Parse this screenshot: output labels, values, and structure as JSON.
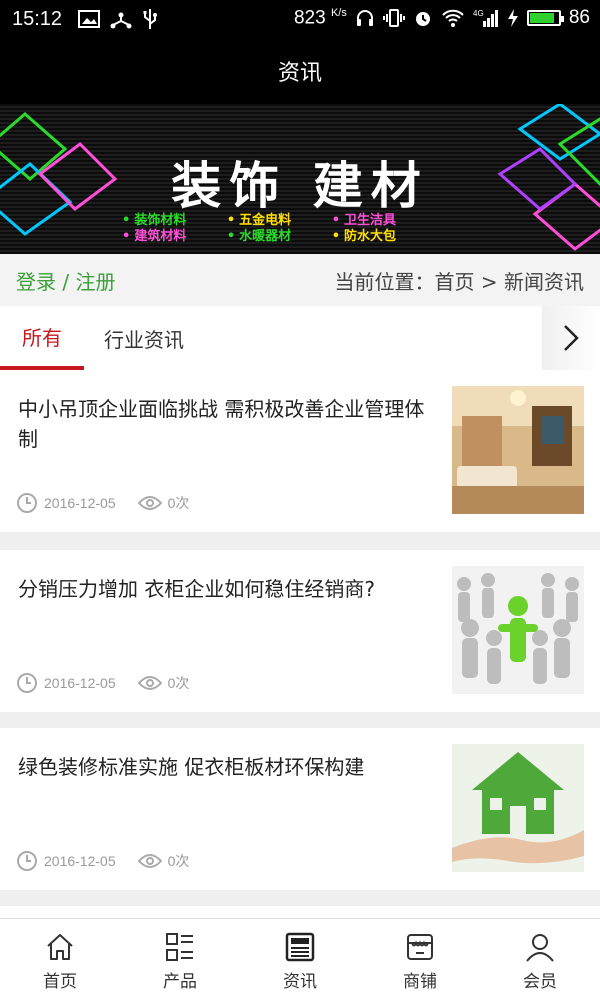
{
  "status_bar": {
    "time": "15:12",
    "net_speed": "823",
    "net_speed_unit": "K/s",
    "signal": "4G",
    "battery": "86",
    "battery_level": 0.86,
    "icons": [
      "image-icon",
      "usb-share-icon",
      "usb-icon",
      "headset-icon",
      "vibrate-icon",
      "alarm-icon",
      "wifi-icon",
      "signal-icon",
      "charging-icon",
      "battery-icon"
    ]
  },
  "header": {
    "title": "资讯"
  },
  "banner": {
    "title": "装饰 建材",
    "row1": [
      "装饰材料",
      "五金电料",
      "卫生洁具"
    ],
    "row2": [
      "建筑材料",
      "水暖器材",
      "防水大包"
    ],
    "row_colors": [
      "#2bdb2b",
      "#ffe000",
      "#ff4fd8"
    ]
  },
  "locbar": {
    "login": "登录 / 注册",
    "location": "当前位置：首页 > 新闻资讯"
  },
  "tabs": {
    "items": [
      "所有",
      "行业资讯"
    ],
    "active_color": "#c8161d"
  },
  "news": [
    {
      "title": "中小吊顶企业面临挑战 需积极改善企业管理体制",
      "date": "2016-12-05",
      "views": "0次"
    },
    {
      "title": "分销压力增加 衣柜企业如何稳住经销商?",
      "date": "2016-12-05",
      "views": "0次"
    },
    {
      "title": "绿色装修标准实施 促衣柜板材环保构建",
      "date": "2016-12-05",
      "views": "0次"
    }
  ],
  "bottom_nav": [
    {
      "label": "首页",
      "icon": "home-icon"
    },
    {
      "label": "产品",
      "icon": "grid-list-icon"
    },
    {
      "label": "资讯",
      "icon": "news-icon"
    },
    {
      "label": "商铺",
      "icon": "store-icon"
    },
    {
      "label": "会员",
      "icon": "user-icon"
    }
  ]
}
